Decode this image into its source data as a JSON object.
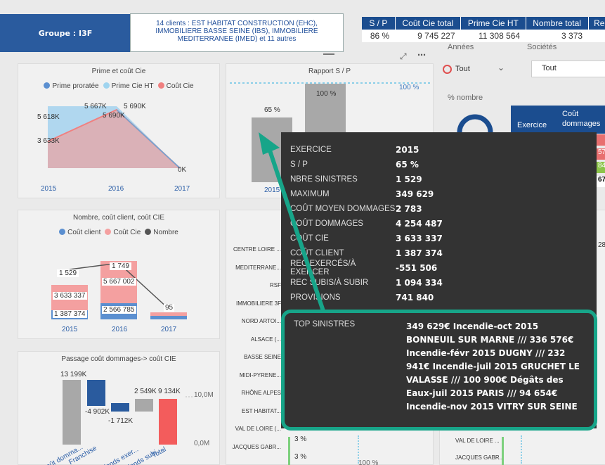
{
  "header": {
    "groupe": "Groupe : I3F",
    "clients": "14 clients : EST HABITAT CONSTRUCTION (EHC), IMMOBILIERE BASSE SEINE (IBS), IMMOBILIERE MEDITERRANEE (IMED) et 11 autres"
  },
  "kpi": {
    "headers": [
      "S / P",
      "Coût Cie total",
      "Prime Cie HT",
      "Nombre total",
      "Rec"
    ],
    "values": [
      "86 %",
      "9 745 227",
      "11 308 564",
      "3 373",
      ""
    ]
  },
  "filters": {
    "annees_label": "Années",
    "annees_value": "Tout",
    "societes_label": "Sociétés",
    "societes_value": "Tout",
    "pct_label": "% nombre"
  },
  "chart1": {
    "title": "Prime et coût Cie",
    "legend": [
      "Prime proratée",
      "Prime Cie HT",
      "Coût Cie"
    ],
    "labels": [
      "5 618K",
      "3 633K",
      "5 667K",
      "5 690K",
      "5 690K",
      "0K"
    ],
    "axis": [
      "2015",
      "2016",
      "2017"
    ]
  },
  "chart2": {
    "title": "Rapport S / P",
    "values": [
      "65 %",
      "100 %"
    ],
    "ref": "100 %",
    "axis": [
      "2015"
    ]
  },
  "chart3": {
    "title": "Nombre, coût client, coût CIE",
    "legend": [
      "Coût client",
      "Coût Cie",
      "Nombre"
    ],
    "labels": [
      "1 529",
      "3 633 337",
      "1 387 374",
      "1 749",
      "5 667 002",
      "2 566 785",
      "95"
    ],
    "axis": [
      "2015",
      "2016",
      "2017"
    ]
  },
  "chart4": {
    "title": "Passage coût dommages-> coût CIE",
    "labels": [
      "13 199K",
      "-4 902K",
      "-1 712K",
      "2 549K",
      "9 134K"
    ],
    "yaxis": [
      "10,0M",
      "0,0M"
    ],
    "xaxis": [
      "Coût domma...",
      "Franchise",
      "Plafonds exer...",
      "Plafonds subi...",
      "Total"
    ]
  },
  "companies": [
    "CENTRE LOIRE ...",
    "MEDITERRANE...",
    "RSF",
    "IMMOBILIERE 3F",
    "NORD ARTOI...",
    "ALSACE (...",
    "BASSE SEINE",
    "MIDI-PYRENE...",
    "RHÔNE ALPES",
    "EST HABITAT...",
    "VAL DE LOIRE (...",
    "JACQUES GABR..."
  ],
  "bottom": {
    "pct1": "3 %",
    "pct2": "3 %",
    "pct100": "100 %",
    "right1": "VAL DE LOIRE ...",
    "right2": "JACQUES GABR...",
    "right_num1": "28"
  },
  "table_right": {
    "h1": "Exercice",
    "h2": "Coût dommages",
    "vals": [
      "57",
      "84",
      "67"
    ]
  },
  "tooltip": {
    "rows": [
      {
        "k": "EXERCICE",
        "v": "2015"
      },
      {
        "k": "S / P",
        "v": "65 %"
      },
      {
        "k": "NBRE SINISTRES",
        "v": "1 529"
      },
      {
        "k": "MAXIMUM",
        "v": "349 629"
      },
      {
        "k": "COÛT MOYEN DOMMAGES",
        "v": "2 783"
      },
      {
        "k": "COÛT DOMMAGES",
        "v": "4 254 487"
      },
      {
        "k": "COÛT CIE",
        "v": "3 633 337"
      },
      {
        "k": "COÛT CLIENT",
        "v": "1 387 374"
      },
      {
        "k": "REC EXERCÉS/À EXERCER",
        "v": "-551 506"
      },
      {
        "k": "REC SUBIS/À SUBIR",
        "v": "1 094 334"
      },
      {
        "k": "PROVISIONS",
        "v": "741 840"
      }
    ],
    "top_label": "TOP SINISTRES",
    "top_value": "349 629€ Incendie-oct 2015 BONNEUIL SUR MARNE /// 336 576€ Incendie-févr 2015 DUGNY /// 232 941€ Incendie-juil 2015 GRUCHET LE VALASSE /// 100 900€ Dégâts des Eaux-juil 2015 PARIS /// 94 654€ Incendie-nov 2015 VITRY SUR SEINE"
  }
}
